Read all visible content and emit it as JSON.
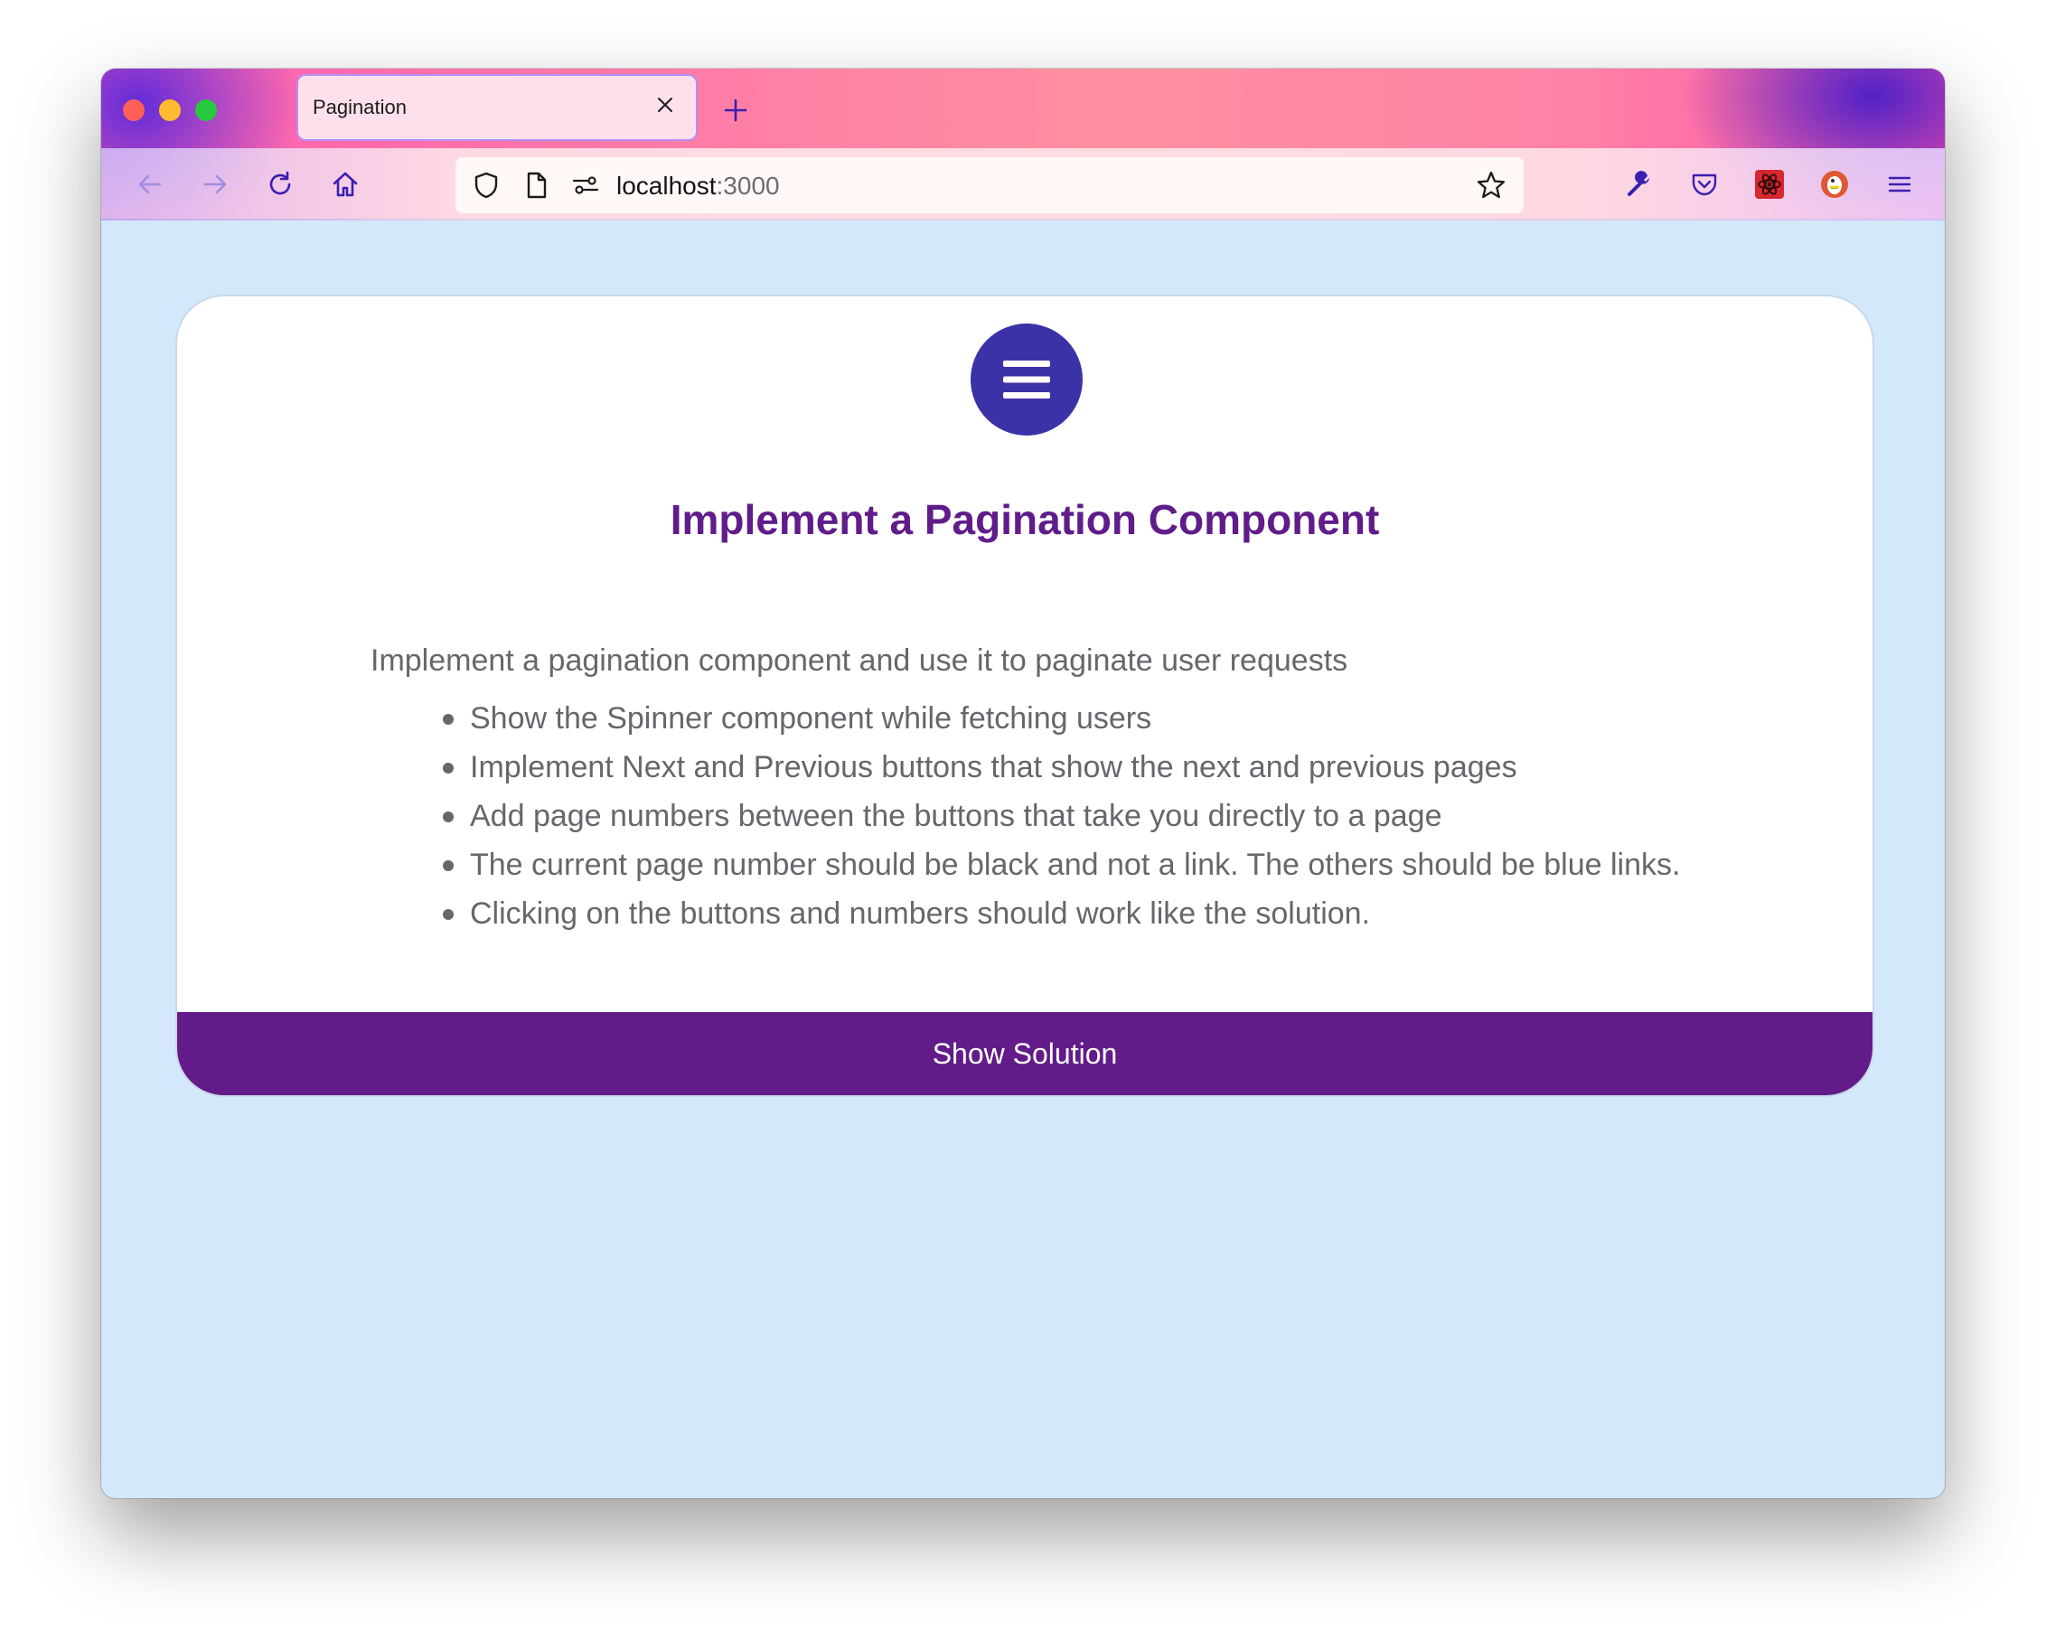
{
  "browser": {
    "tab_title": "Pagination",
    "url_host": "localhost",
    "url_port": ":3000",
    "icons": {
      "tab_close": "close-icon",
      "new_tab": "plus-icon",
      "back": "arrow-left-icon",
      "forward": "arrow-right-icon",
      "reload": "reload-icon",
      "home": "home-icon",
      "tracking": "shield-icon",
      "page_info": "document-icon",
      "permissions": "sliders-icon",
      "bookmark": "star-icon",
      "devtools": "wrench-icon",
      "pocket": "pocket-icon",
      "react_devtools": "react-extension-icon",
      "duckduckgo": "duckduckgo-icon",
      "app_menu": "hamburger-menu-icon"
    }
  },
  "card": {
    "icon": "hamburger-menu-icon",
    "title": "Implement a Pagination Component",
    "intro": "Implement a pagination component and use it to paginate user requests",
    "requirements": [
      "Show the Spinner component while fetching users",
      "Implement Next and Previous buttons that show the next and previous pages",
      "Add page numbers between the buttons that take you directly to a page",
      "The current page number should be black and not a link. The others should be blue links.",
      "Clicking on the buttons and numbers should work like the solution."
    ],
    "solution_button": "Show Solution"
  },
  "colors": {
    "page_background": "#d4e8fc",
    "title": "#601c8a",
    "button": "#621b89",
    "menu_circle": "#3b32a8",
    "body_text": "#66666c"
  }
}
